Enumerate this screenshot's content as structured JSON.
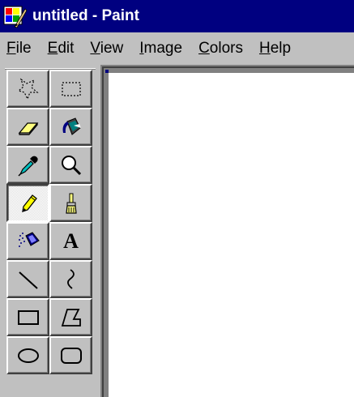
{
  "window": {
    "title": "untitled - Paint",
    "title_bar_color": "#000080",
    "face_color": "#c0c0c0",
    "canvas_color": "#ffffff"
  },
  "menu": {
    "items": [
      {
        "accel": "F",
        "rest": "ile"
      },
      {
        "accel": "E",
        "rest": "dit"
      },
      {
        "accel": "V",
        "rest": "iew"
      },
      {
        "accel": "I",
        "rest": "mage"
      },
      {
        "accel": "C",
        "rest": "olors"
      },
      {
        "accel": "H",
        "rest": "elp"
      }
    ]
  },
  "toolbox": {
    "tools": [
      {
        "id": "free-form-select",
        "icon": "free-form-select-icon",
        "pressed": false
      },
      {
        "id": "rect-select",
        "icon": "rect-select-icon",
        "pressed": false
      },
      {
        "id": "eraser",
        "icon": "eraser-icon",
        "pressed": false
      },
      {
        "id": "fill",
        "icon": "paint-bucket-icon",
        "pressed": false
      },
      {
        "id": "pick-color",
        "icon": "eyedropper-icon",
        "pressed": false
      },
      {
        "id": "magnifier",
        "icon": "magnifier-icon",
        "pressed": false
      },
      {
        "id": "pencil",
        "icon": "pencil-icon",
        "pressed": true
      },
      {
        "id": "brush",
        "icon": "brush-icon",
        "pressed": false
      },
      {
        "id": "airbrush",
        "icon": "airbrush-icon",
        "pressed": false
      },
      {
        "id": "text",
        "icon": "text-icon",
        "label": "A",
        "pressed": false
      },
      {
        "id": "line",
        "icon": "line-icon",
        "pressed": false
      },
      {
        "id": "curve",
        "icon": "curve-icon",
        "pressed": false
      },
      {
        "id": "rectangle",
        "icon": "rectangle-icon",
        "pressed": false
      },
      {
        "id": "polygon",
        "icon": "polygon-icon",
        "pressed": false
      },
      {
        "id": "ellipse",
        "icon": "ellipse-icon",
        "pressed": false
      },
      {
        "id": "rounded-rectangle",
        "icon": "rounded-rectangle-icon",
        "pressed": false
      }
    ]
  }
}
